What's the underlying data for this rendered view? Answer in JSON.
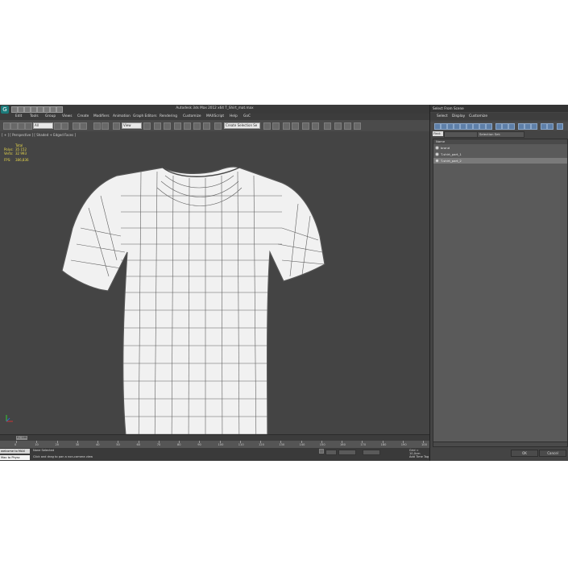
{
  "app": {
    "title": "Autodesk 3ds Max 2012 x64    T_Shirt_mat.max",
    "menu": [
      "Edit",
      "Tools",
      "Group",
      "Views",
      "Create",
      "Modifiers",
      "Animation",
      "Graph Editors",
      "Rendering",
      "Customize",
      "MAXScript",
      "Help",
      "GoC"
    ],
    "toolbar": {
      "filter_value": "All",
      "ref_coord_value": "View",
      "selection_set_value": "Create Selection Se"
    }
  },
  "viewport": {
    "label": "[ + ] [ Perspective ] [ Shaded + Edged Faces ]",
    "stats": {
      "header": "Total",
      "polys_label": "Polys:",
      "polys_value": "35 152",
      "verts_label": "Verts:",
      "verts_value": "32 993",
      "fps_label": "FPS:",
      "fps_value": "386,836"
    }
  },
  "timeline": {
    "slider_label": "0 / 100",
    "ticks": [
      "0",
      "10",
      "20",
      "30",
      "40",
      "50",
      "60",
      "70",
      "80",
      "90",
      "100",
      "110",
      "120",
      "130",
      "140",
      "150",
      "160",
      "170",
      "180",
      "190",
      "100"
    ]
  },
  "statusbar": {
    "script_label": "welcome to MAX",
    "script_label2": "Max to Physc",
    "none_selected": "None Selected",
    "prompt": "Click and drag to pan a non-camera view",
    "grid": "Grid = 10,0cm",
    "add_time_tag": "Add Time Tag"
  },
  "dialog": {
    "title": "Select From Scene",
    "menu": [
      "Select",
      "Display",
      "Customize"
    ],
    "find_label": "Find:",
    "selection_set_label": "Selection Set:",
    "list_header": "Name",
    "items": [
      {
        "name": "brand",
        "selected": false
      },
      {
        "name": "T-shirt_part_1",
        "selected": false
      },
      {
        "name": "T-shirt_part_2",
        "selected": true
      }
    ],
    "ok_label": "OK",
    "cancel_label": "Cancel"
  }
}
